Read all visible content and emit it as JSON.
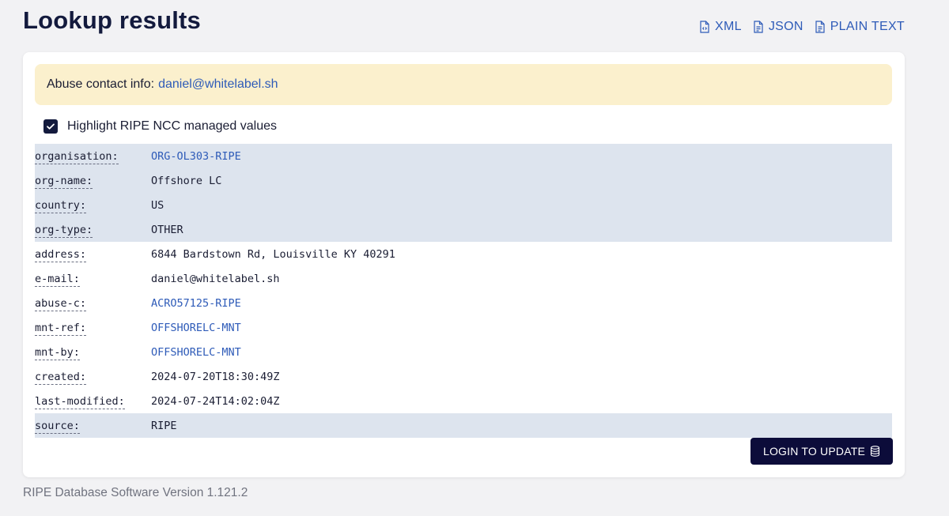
{
  "page_title": "Lookup results",
  "exports": [
    {
      "label": "XML",
      "icon": "file-code-icon"
    },
    {
      "label": "JSON",
      "icon": "file-text-icon"
    },
    {
      "label": "PLAIN TEXT",
      "icon": "file-text-icon"
    }
  ],
  "abuse": {
    "prefix": "Abuse contact info:",
    "email": "daniel@whitelabel.sh"
  },
  "highlight": {
    "label": "Highlight RIPE NCC managed values",
    "checked": true
  },
  "attributes": [
    {
      "key": "organisation:",
      "value": "ORG-OL303-RIPE",
      "link": true,
      "managed": true
    },
    {
      "key": "org-name:",
      "value": "Offshore LC",
      "link": false,
      "managed": true
    },
    {
      "key": "country:",
      "value": "US",
      "link": false,
      "managed": true
    },
    {
      "key": "org-type:",
      "value": "OTHER",
      "link": false,
      "managed": true
    },
    {
      "key": "address:",
      "value": "6844 Bardstown Rd, Louisville KY 40291",
      "link": false,
      "managed": false
    },
    {
      "key": "e-mail:",
      "value": "daniel@whitelabel.sh",
      "link": false,
      "managed": false
    },
    {
      "key": "abuse-c:",
      "value": "ACRO57125-RIPE",
      "link": true,
      "managed": false
    },
    {
      "key": "mnt-ref:",
      "value": "OFFSHORELC-MNT",
      "link": true,
      "managed": false
    },
    {
      "key": "mnt-by:",
      "value": "OFFSHORELC-MNT",
      "link": true,
      "managed": false
    },
    {
      "key": "created:",
      "value": "2024-07-20T18:30:49Z",
      "link": false,
      "managed": false
    },
    {
      "key": "last-modified:",
      "value": "2024-07-24T14:02:04Z",
      "link": false,
      "managed": false
    },
    {
      "key": "source:",
      "value": "RIPE",
      "link": false,
      "managed": true
    }
  ],
  "login_button": {
    "label": "LOGIN TO UPDATE",
    "icon": "database-icon"
  },
  "footer": "RIPE Database Software Version 1.121.2",
  "colors": {
    "accent_link": "#2e5bb8",
    "managed_row_bg": "#dde4ee",
    "abuse_bg": "#fbf0cd",
    "button_bg": "#0c0c3a"
  }
}
